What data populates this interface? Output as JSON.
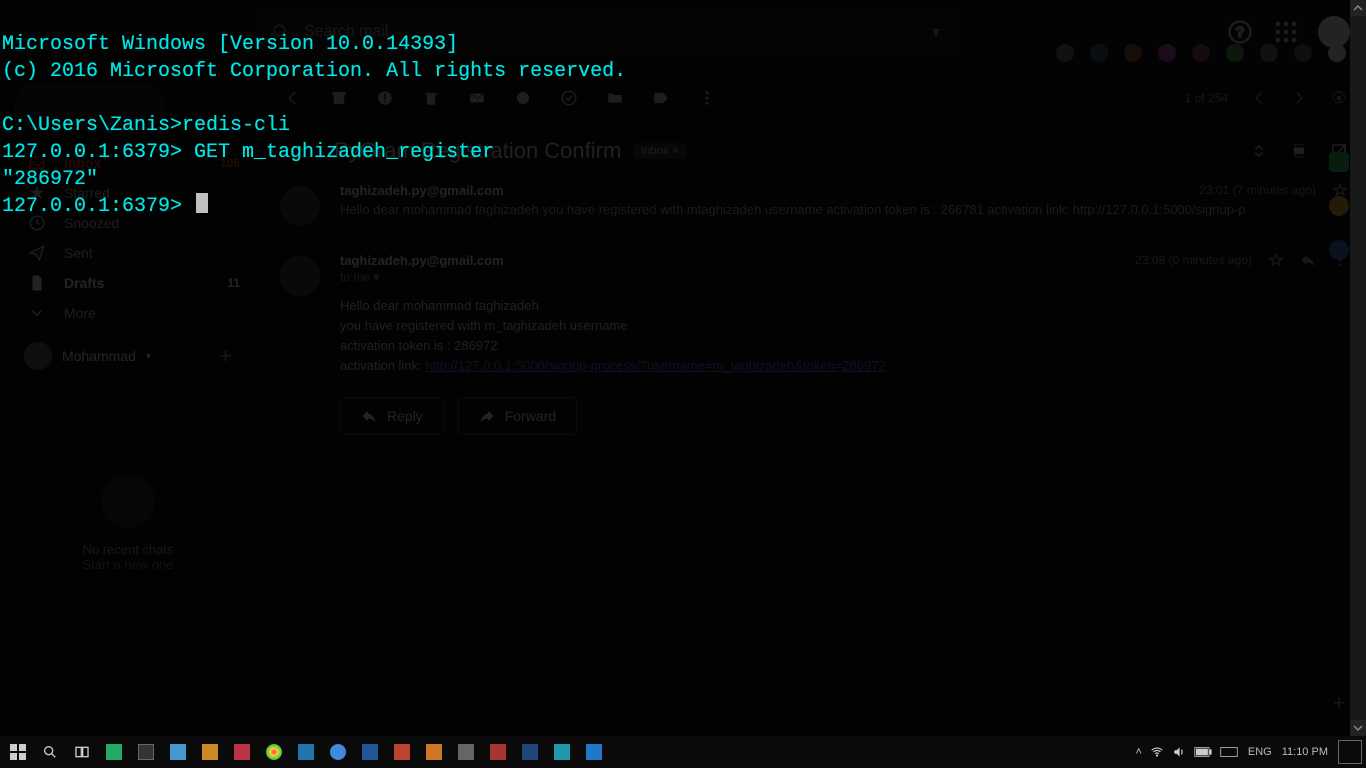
{
  "terminal": {
    "line1": "Microsoft Windows [Version 10.0.14393]",
    "line2": "(c) 2016 Microsoft Corporation. All rights reserved.",
    "prompt1": "C:\\Users\\Zanis>redis-cli",
    "prompt2": "127.0.0.1:6379> GET m_taghizadeh_register",
    "result": "\"286972\"",
    "prompt3": "127.0.0.1:6379> "
  },
  "gmail": {
    "search_placeholder": "Search mail",
    "sidebar": {
      "items": [
        {
          "label": "Inbox",
          "count": "106",
          "icon": "inbox"
        },
        {
          "label": "Starred",
          "count": "",
          "icon": "star"
        },
        {
          "label": "Snoozed",
          "count": "",
          "icon": "clock"
        },
        {
          "label": "Sent",
          "count": "",
          "icon": "send"
        },
        {
          "label": "Drafts",
          "count": "11",
          "icon": "file"
        },
        {
          "label": "More",
          "count": "",
          "icon": "chev"
        }
      ],
      "user": "Mohammad",
      "hangouts_line1": "No recent chats",
      "hangouts_line2": "Start a new one"
    },
    "nav": {
      "counter": "1 of 254"
    },
    "thread": {
      "subject": "PyGram Registration Confirm",
      "chip": "Inbox",
      "msg1": {
        "from": "taghizadeh.py@gmail.com",
        "time": "23:01 (7 minutes ago)",
        "snippet": "Hello dear mohammad taghizadeh you have registered with mtaghizadeh username activation token is : 266781 activation link: http://127.0.0.1:5000/signup-p"
      },
      "msg2": {
        "from": "taghizadeh.py@gmail.com",
        "to": "to me",
        "time": "23:08 (0 minutes ago)",
        "bodyL1": "Hello dear mohammad taghizadeh",
        "bodyL2": "you have registered with m_taghizadeh username",
        "bodyL3": "activation token is : 286972",
        "bodyL4a": "activation link: ",
        "bodyL4link": "http://127.0.0.1:5000/signup-process/?username=m_taghizadeh&token=286972"
      },
      "reply": "Reply",
      "forward": "Forward"
    }
  },
  "taskbar": {
    "lang": "ENG",
    "time": "11:10 PM"
  }
}
